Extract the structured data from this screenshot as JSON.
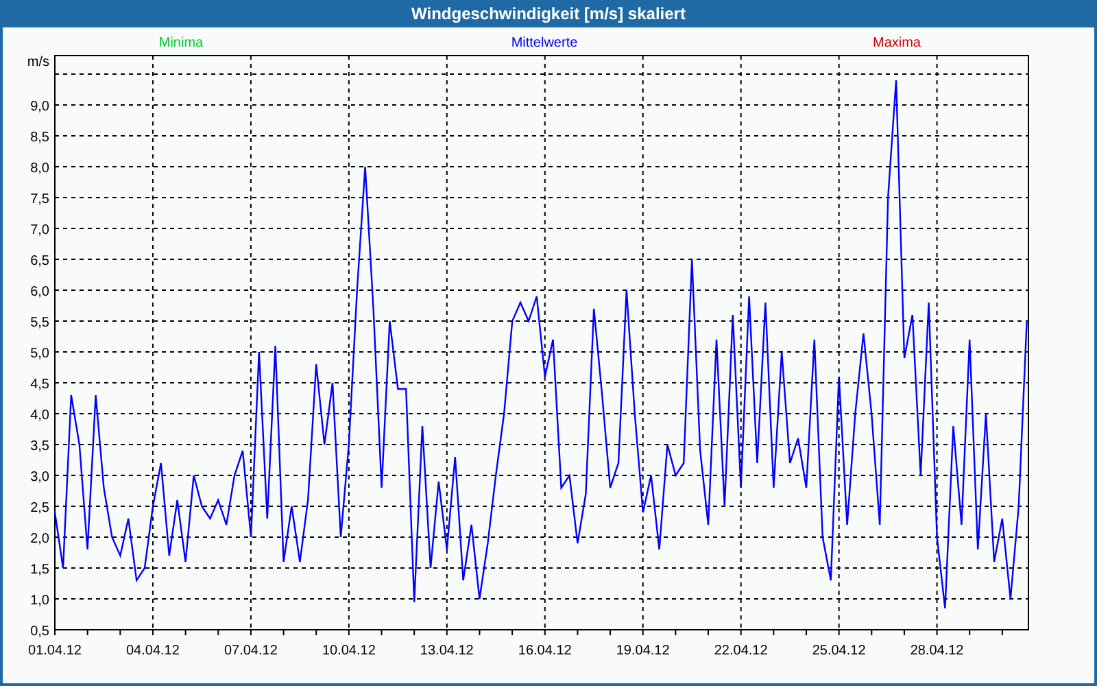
{
  "window": {
    "title": "Windgeschwindigkeit [m/s] skaliert"
  },
  "legend": [
    {
      "label": "Minima",
      "color": "#00cc33"
    },
    {
      "label": "Maxima",
      "color": "#cc0000"
    }
  ],
  "chart": {
    "chart_data": {
      "type": "line",
      "grid": true,
      "ylabel": "m/s",
      "ylim": [
        0.5,
        9.8
      ],
      "categories": [
        "01.04.12",
        null,
        null,
        null,
        null,
        null,
        null,
        null,
        null,
        null,
        null,
        null,
        "04.04.12",
        null,
        null,
        null,
        null,
        null,
        null,
        null,
        null,
        null,
        null,
        null,
        "07.04.12",
        null,
        null,
        null,
        null,
        null,
        null,
        null,
        null,
        null,
        null,
        null,
        "10.04.12",
        null,
        null,
        null,
        null,
        null,
        null,
        null,
        null,
        null,
        null,
        null,
        "13.04.12",
        null,
        null,
        null,
        null,
        null,
        null,
        null,
        null,
        null,
        null,
        null,
        "16.04.12",
        null,
        null,
        null,
        null,
        null,
        null,
        null,
        null,
        null,
        null,
        null,
        "19.04.12",
        null,
        null,
        null,
        null,
        null,
        null,
        null,
        null,
        null,
        null,
        null,
        "22.04.12",
        null,
        null,
        null,
        null,
        null,
        null,
        null,
        null,
        null,
        null,
        null,
        "25.04.12",
        null,
        null,
        null,
        null,
        null,
        null,
        null,
        null,
        null,
        null,
        null,
        "28.04.12",
        null,
        null,
        null,
        null,
        null,
        null,
        null,
        null,
        null,
        null,
        null
      ],
      "series": [
        {
          "name": "Mittelwerte",
          "color": "#0000ff",
          "values": [
            2.4,
            1.5,
            4.3,
            3.5,
            1.8,
            4.3,
            2.8,
            2.0,
            1.7,
            2.3,
            1.3,
            1.5,
            2.5,
            3.2,
            1.7,
            2.6,
            1.6,
            3.0,
            2.5,
            2.3,
            2.6,
            2.2,
            3.0,
            3.4,
            2.0,
            5.0,
            2.3,
            5.1,
            1.6,
            2.5,
            1.6,
            2.6,
            4.8,
            3.5,
            4.5,
            2.0,
            3.5,
            6.0,
            8.0,
            5.7,
            2.8,
            5.5,
            4.4,
            4.4,
            0.95,
            3.8,
            1.5,
            2.9,
            1.8,
            3.3,
            1.3,
            2.2,
            1.0,
            1.9,
            3.0,
            4.0,
            5.5,
            5.8,
            5.5,
            5.9,
            4.6,
            5.2,
            2.8,
            3.0,
            1.9,
            2.7,
            5.7,
            4.3,
            2.8,
            3.2,
            6.0,
            4.0,
            2.4,
            3.0,
            1.8,
            3.5,
            3.0,
            3.2,
            6.5,
            3.4,
            2.2,
            5.2,
            2.5,
            5.6,
            2.8,
            5.9,
            3.2,
            5.8,
            2.8,
            5.0,
            3.2,
            3.6,
            2.8,
            5.2,
            2.0,
            1.3,
            4.6,
            2.2,
            4.0,
            5.3,
            4.0,
            2.2,
            7.5,
            9.4,
            4.9,
            5.6,
            3.0,
            5.8,
            2.0,
            0.85,
            3.8,
            2.2,
            5.2,
            1.8,
            4.0,
            1.6,
            2.3,
            1.0,
            2.5,
            5.5
          ]
        }
      ],
      "yticks": [
        {
          "value": 0.5,
          "label": "0,5"
        },
        {
          "value": 1,
          "label": "1,0"
        },
        {
          "value": 1.5,
          "label": "1,5"
        },
        {
          "value": 2,
          "label": "2,0"
        },
        {
          "value": 2.5,
          "label": "2,5"
        },
        {
          "value": 3,
          "label": "3,0"
        },
        {
          "value": 3.5,
          "label": "3,5"
        },
        {
          "value": 4,
          "label": "4,0"
        },
        {
          "value": 4.5,
          "label": "4,5"
        },
        {
          "value": 5,
          "label": "5,0"
        },
        {
          "value": 5.5,
          "label": "5,5"
        },
        {
          "value": 6,
          "label": "6,0"
        },
        {
          "value": 6.5,
          "label": "6,5"
        },
        {
          "value": 7,
          "label": "7,0"
        },
        {
          "value": 7.5,
          "label": "7,5"
        },
        {
          "value": 8,
          "label": "8,0"
        },
        {
          "value": 8.5,
          "label": "8,5"
        },
        {
          "value": 9,
          "label": "9,0"
        }
      ]
    }
  }
}
